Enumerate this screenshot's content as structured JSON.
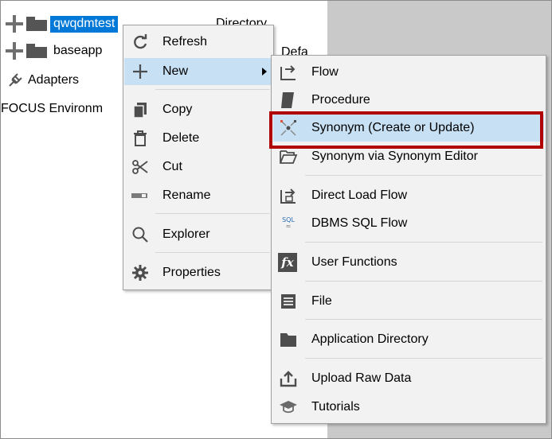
{
  "tree": {
    "items": [
      {
        "label": "qwqdmtest"
      },
      {
        "label": "baseapp"
      },
      {
        "label": "Adapters"
      },
      {
        "label": "FOCUS Environm"
      }
    ],
    "col_type": "Directory",
    "col_default": "Defa"
  },
  "context_menu": {
    "items": [
      {
        "label": "Refresh",
        "icon": "refresh-icon"
      },
      {
        "label": "New",
        "icon": "plus-icon"
      },
      {
        "label": "Copy",
        "icon": "copy-icon"
      },
      {
        "label": "Delete",
        "icon": "trash-icon"
      },
      {
        "label": "Cut",
        "icon": "scissors-icon"
      },
      {
        "label": "Rename",
        "icon": "rename-icon"
      },
      {
        "label": "Explorer",
        "icon": "search-icon"
      },
      {
        "label": "Properties",
        "icon": "gear-icon"
      }
    ]
  },
  "submenu": {
    "items": [
      {
        "label": "Flow",
        "icon": "flow-icon"
      },
      {
        "label": "Procedure",
        "icon": "procedure-icon"
      },
      {
        "label": "Synonym (Create or Update)",
        "icon": "synonym-icon",
        "highlighted": true
      },
      {
        "label": "Synonym via Synonym Editor",
        "icon": "open-folder-icon"
      },
      {
        "label": "Direct Load Flow",
        "icon": "direct-load-flow-icon"
      },
      {
        "label": "DBMS SQL Flow",
        "icon": "sql-flow-icon",
        "icon_text": "SQL"
      },
      {
        "label": "User Functions",
        "icon": "fx-icon",
        "icon_text": "fx"
      },
      {
        "label": "File",
        "icon": "file-icon"
      },
      {
        "label": "Application Directory",
        "icon": "folder-icon"
      },
      {
        "label": "Upload Raw Data",
        "icon": "upload-icon"
      },
      {
        "label": "Tutorials",
        "icon": "graduation-cap-icon"
      }
    ]
  },
  "colors": {
    "selection": "#0078d7",
    "menu_bg": "#f2f2f2",
    "highlight": "#c7e0f4",
    "annotation_box": "#b00000",
    "right_pane": "#c9c9c9"
  }
}
